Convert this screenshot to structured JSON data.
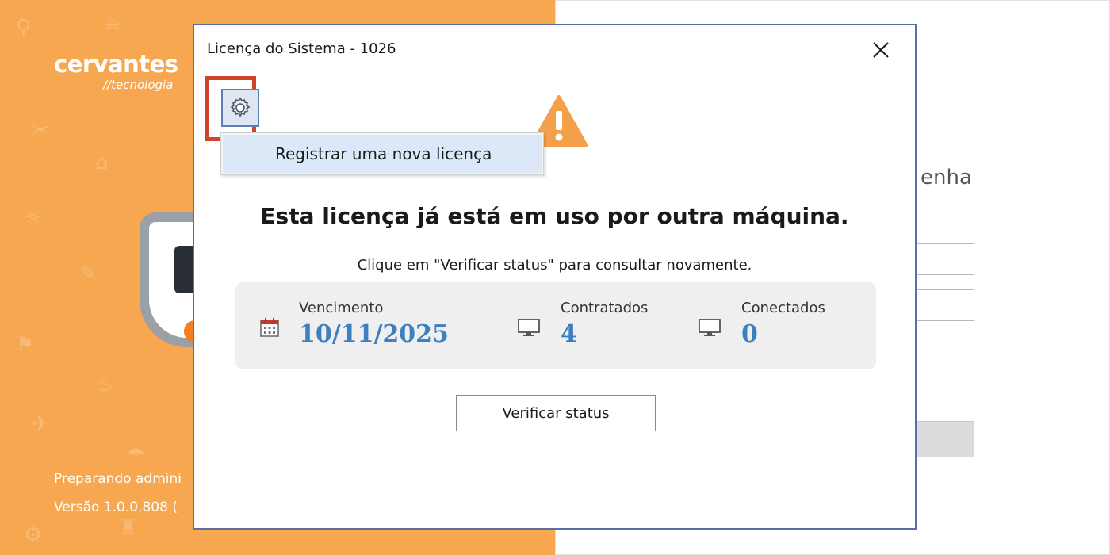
{
  "splash": {
    "brand_name": "cervantes",
    "brand_sub": "//tecnologia",
    "status_text": "Preparando admini",
    "version_text": "Versão 1.0.0.808 ("
  },
  "login": {
    "heading_fragment": "enha"
  },
  "dialog": {
    "title": "Licença do Sistema - 1026",
    "menu": {
      "items": [
        {
          "label": "Registrar uma nova licença"
        }
      ]
    },
    "headline": "Esta licença já está em uso por outra máquina.",
    "subtext": "Clique em \"Verificar status\" para consultar novamente.",
    "info": {
      "vencimento_label": "Vencimento",
      "vencimento_value": "10/11/2025",
      "contratados_label": "Contratados",
      "contratados_value": "4",
      "conectados_label": "Conectados",
      "conectados_value": "0"
    },
    "verify_label": "Verificar status"
  },
  "icons": {
    "close": "close-icon",
    "gear": "gear-icon",
    "warning": "warning-icon",
    "calendar": "calendar-icon",
    "monitor": "monitor-icon"
  },
  "colors": {
    "splash_orange": "#f7a750",
    "accent_blue": "#3d7fc1",
    "highlight_red": "#d0422a",
    "warning_orange": "#f4a04a"
  }
}
